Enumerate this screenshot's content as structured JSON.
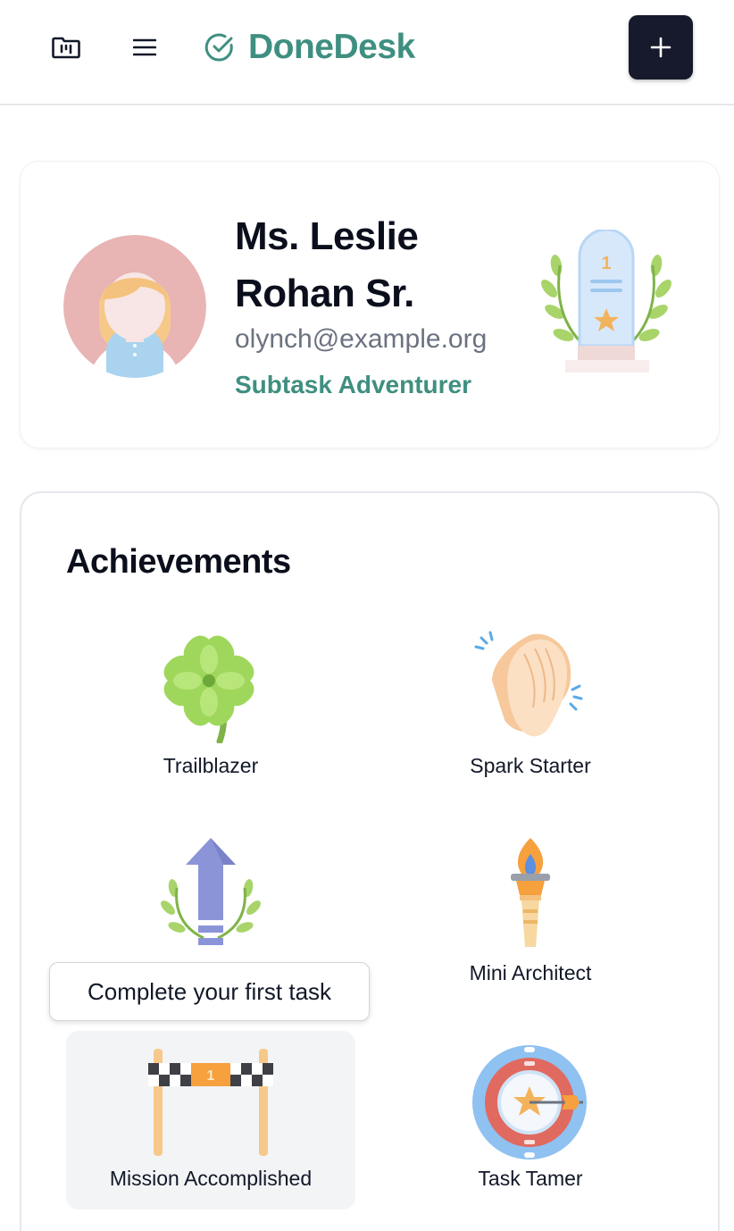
{
  "app": {
    "brand_name": "DoneDesk",
    "brand_color": "#3f8f80",
    "icons": [
      "kanban-board-icon",
      "hamburger-menu-icon",
      "check-circle-icon",
      "plus-icon"
    ]
  },
  "profile": {
    "name": "Ms. Leslie Rohan Sr.",
    "email": "olynch@example.org",
    "rank": "Subtask Adventurer",
    "trophy_icon": "trophy-laurel-icon",
    "avatar_icon": "avatar-girl-icon"
  },
  "achievements": {
    "title": "Achievements",
    "items": [
      {
        "label": "Trailblazer",
        "icon": "four-leaf-clover-icon"
      },
      {
        "label": "Spark Starter",
        "icon": "clapping-hands-icon"
      },
      {
        "label": "",
        "icon": "up-arrow-laurel-icon"
      },
      {
        "label": "Mini Architect",
        "icon": "torch-icon"
      },
      {
        "label": "Mission Accomplished",
        "icon": "finish-line-icon"
      },
      {
        "label": "Task Tamer",
        "icon": "target-dart-icon"
      }
    ],
    "tooltip": "Complete your first task"
  }
}
